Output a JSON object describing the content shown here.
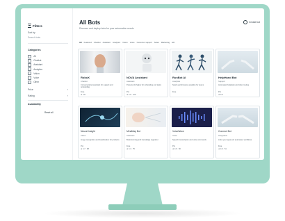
{
  "page": {
    "title": "All Bots",
    "subtitle": "Discover and deploy bots for your automation needs",
    "top_button": "Create bot"
  },
  "sidebar": {
    "filter_label": "Filters",
    "sort_label": "Sort by",
    "search_placeholder": "Search bots",
    "category_label": "Categories",
    "options": [
      "All",
      "Chatbot",
      "Assistant",
      "Analytics",
      "Vision",
      "Voice",
      "Other"
    ],
    "rows": [
      {
        "label": "Price",
        "value": "›"
      },
      {
        "label": "Rating",
        "value": "›"
      }
    ],
    "section2_label": "Availability",
    "reset_link": "Reset all"
  },
  "chips": [
    "All",
    "Featured",
    "Chatbot",
    "Assistant",
    "Analytics",
    "Vision",
    "Voice",
    "Customer support",
    "Sales",
    "Marketing",
    "HR"
  ],
  "cards_row1": [
    {
      "title": "RoboX",
      "sub": "Chatbot",
      "desc": "Conversational assistant for support and onboarding",
      "meta": "Free",
      "meta2": "★ 4.8"
    },
    {
      "title": "NOVA Assistant",
      "sub": "Assistant",
      "desc": "Personal AI helper for scheduling and tasks",
      "meta": "Pro",
      "meta2": "★ 4.6 · 120"
    },
    {
      "title": "RunBot AI",
      "sub": "Analytics",
      "desc": "Sports performance analytics for teams",
      "meta": "Free",
      "meta2": ""
    },
    {
      "title": "HelpHand Bot",
      "sub": "Support",
      "desc": "Automated helpdesk and ticket routing",
      "meta": "Pro",
      "meta2": "★ 4.5"
    }
  ],
  "cards_row2": [
    {
      "title": "Neural Insight",
      "sub": "Vision",
      "desc": "Image recognition and classification for products",
      "meta": "Pro",
      "meta2": "★ 4.7 · 98"
    },
    {
      "title": "MindMap Bot",
      "sub": "Assistant",
      "desc": "Brainstorming and knowledge organizer",
      "meta": "Free",
      "meta2": "★ 4.4 · 75"
    },
    {
      "title": "VoiceWave",
      "sub": "Voice",
      "desc": "Speech transcription and voice commands",
      "meta": "Pro",
      "meta2": "★ 4.6 · 66"
    },
    {
      "title": "Connect Bot",
      "sub": "Integration",
      "desc": "Links your apps and automates workflows",
      "meta": "Free",
      "meta2": "★ 4.3 · 51"
    }
  ],
  "colors": {
    "monitor": "#9fd7c7",
    "accent": "#2b3a42"
  }
}
